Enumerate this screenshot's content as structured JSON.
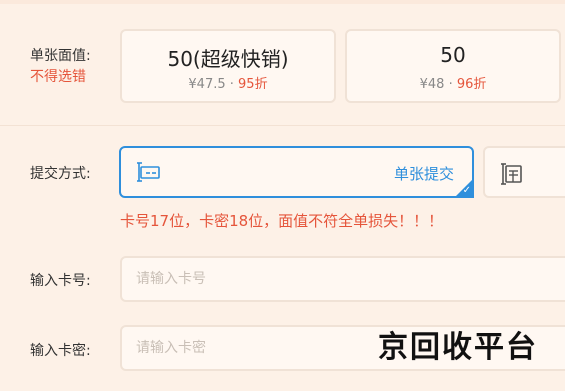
{
  "denomination": {
    "label": "单张面值:",
    "note": "不得选错",
    "options": [
      {
        "value": "50(超级快销)",
        "price": "¥47.5",
        "sep": " · ",
        "discount": "95折"
      },
      {
        "value": "50",
        "price": "¥48",
        "sep": " · ",
        "discount": "96折"
      }
    ]
  },
  "submit_method": {
    "label": "提交方式:",
    "options": [
      {
        "label": "单张提交",
        "icon": "single-card-icon",
        "selected": true
      },
      {
        "label": "",
        "icon": "batch-card-icon",
        "selected": false
      }
    ]
  },
  "warning": "卡号17位，卡密18位，面值不符全单损失！！！",
  "card_number": {
    "label": "输入卡号:",
    "placeholder": "请输入卡号",
    "value": ""
  },
  "card_password": {
    "label": "输入卡密:",
    "placeholder": "请输入卡密",
    "value": ""
  },
  "watermark": "京回收平台",
  "colors": {
    "accent": "#2f8fdc",
    "warning": "#e5553b",
    "background": "#fdf1e7"
  }
}
